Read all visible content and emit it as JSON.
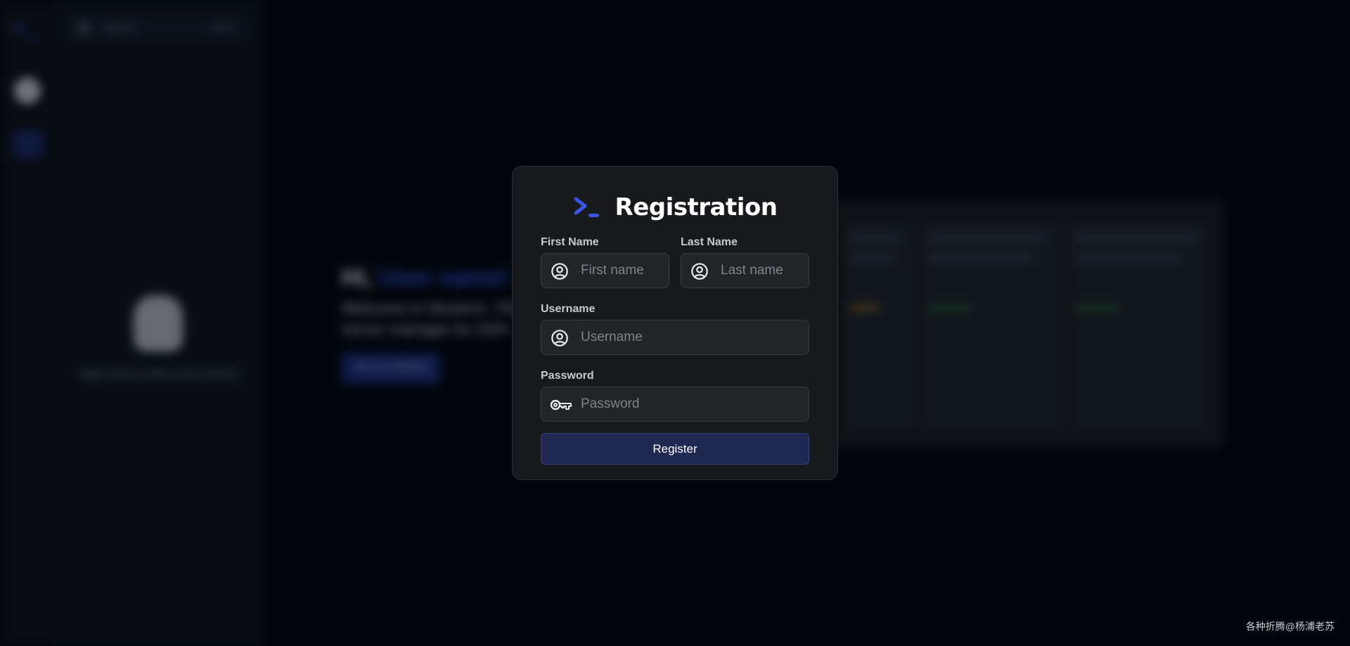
{
  "background": {
    "search_placeholder": "Search",
    "search_shortcut": "Alt+K",
    "side_hint": "Right click to add a new session",
    "welcome_greeting": "Hi,",
    "welcome_name": "User name!",
    "welcome_subtitle": "Welcome to Nexterm. The open source server manager for SSH",
    "welcome_button": "Get on GitHub"
  },
  "modal": {
    "title": "Registration",
    "first_name": {
      "label": "First Name",
      "placeholder": "First name",
      "icon": "account-circle-icon"
    },
    "last_name": {
      "label": "Last Name",
      "placeholder": "Last name",
      "icon": "account-circle-icon"
    },
    "username": {
      "label": "Username",
      "placeholder": "Username",
      "icon": "account-circle-icon"
    },
    "password": {
      "label": "Password",
      "placeholder": "Password",
      "icon": "key-icon"
    },
    "submit_label": "Register"
  },
  "watermark": "各种折腾@杨浦老苏",
  "colors": {
    "accent": "#3a55e6",
    "modal_bg": "#17191d",
    "button_bg": "#1f2850",
    "page_bg": "#02060c"
  }
}
